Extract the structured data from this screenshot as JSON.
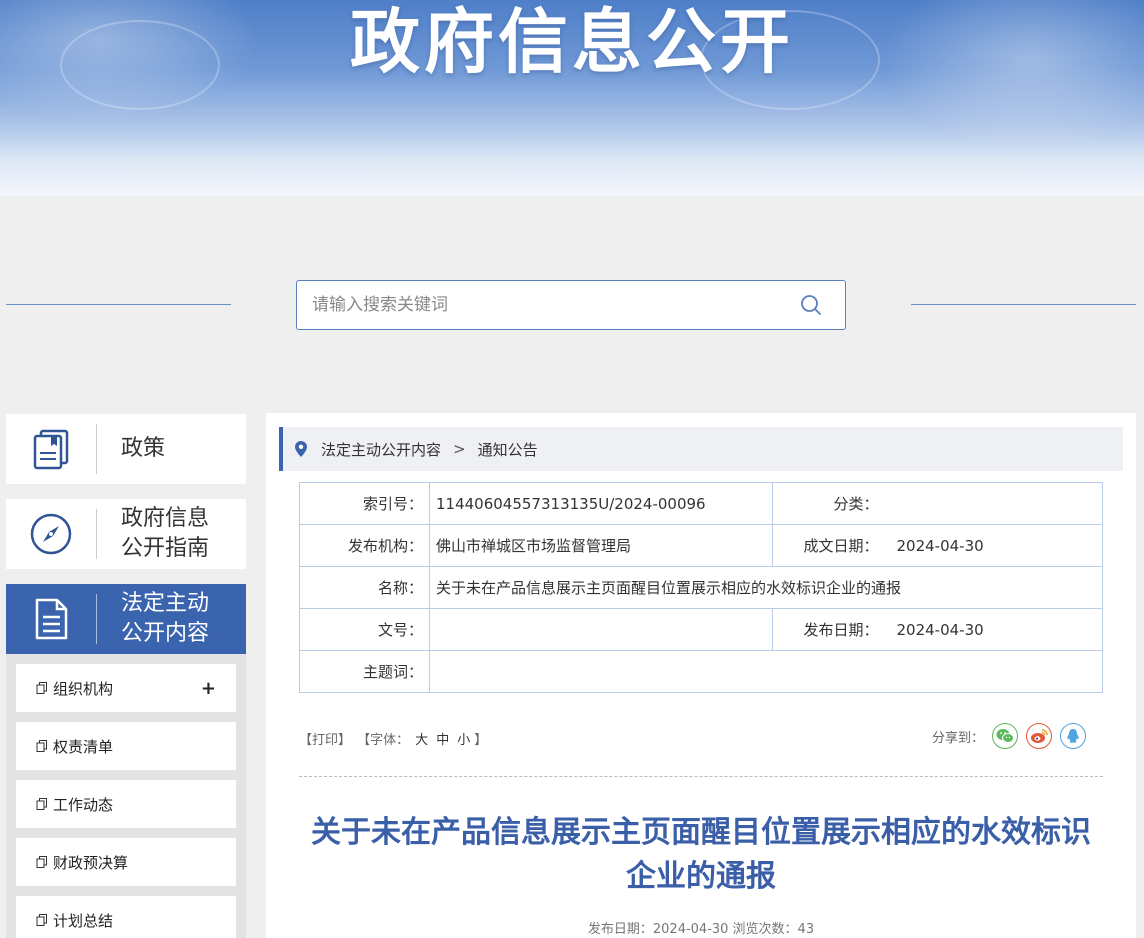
{
  "banner": {
    "title": "政府信息公开"
  },
  "search": {
    "placeholder": "请输入搜索关键词",
    "icon": "search-icon"
  },
  "sidebar": {
    "cards": [
      {
        "label": "政策",
        "icon": "book-icon",
        "active": false
      },
      {
        "label_line1": "政府信息",
        "label_line2": "公开指南",
        "icon": "compass-icon",
        "active": false
      },
      {
        "label_line1": "法定主动",
        "label_line2": "公开内容",
        "icon": "document-icon",
        "active": true
      }
    ],
    "sub_items": [
      {
        "label": "组织机构",
        "expand": "+"
      },
      {
        "label": "权责清单"
      },
      {
        "label": "工作动态"
      },
      {
        "label": "财政预决算"
      },
      {
        "label": "计划总结"
      }
    ]
  },
  "breadcrumb": {
    "items": [
      "法定主动公开内容",
      "通知公告"
    ],
    "separator": ">"
  },
  "info_table": {
    "index_no_label": "索引号：",
    "index_no": "11440604557313135U/2024-00096",
    "category_label": "分类：",
    "category": "",
    "issuer_label": "发布机构：",
    "issuer": "佛山市禅城区市场监督管理局",
    "created_label": "成文日期：",
    "created": "2024-04-30",
    "name_label": "名称：",
    "name": "关于未在产品信息展示主页面醒目位置展示相应的水效标识企业的通报",
    "doc_no_label": "文号：",
    "doc_no": "",
    "published_label": "发布日期：",
    "published": "2024-04-30",
    "keywords_label": "主题词：",
    "keywords": ""
  },
  "tools": {
    "print": "【打印】",
    "font_prefix": "【字体：",
    "font_large": "大",
    "font_medium": "中",
    "font_small": "小",
    "font_suffix": "】",
    "share_label": "分享到："
  },
  "article": {
    "title": "关于未在产品信息展示主页面醒目位置展示相应的水效标识企业的通报",
    "meta": "发布日期：2024-04-30  浏览次数：43"
  }
}
